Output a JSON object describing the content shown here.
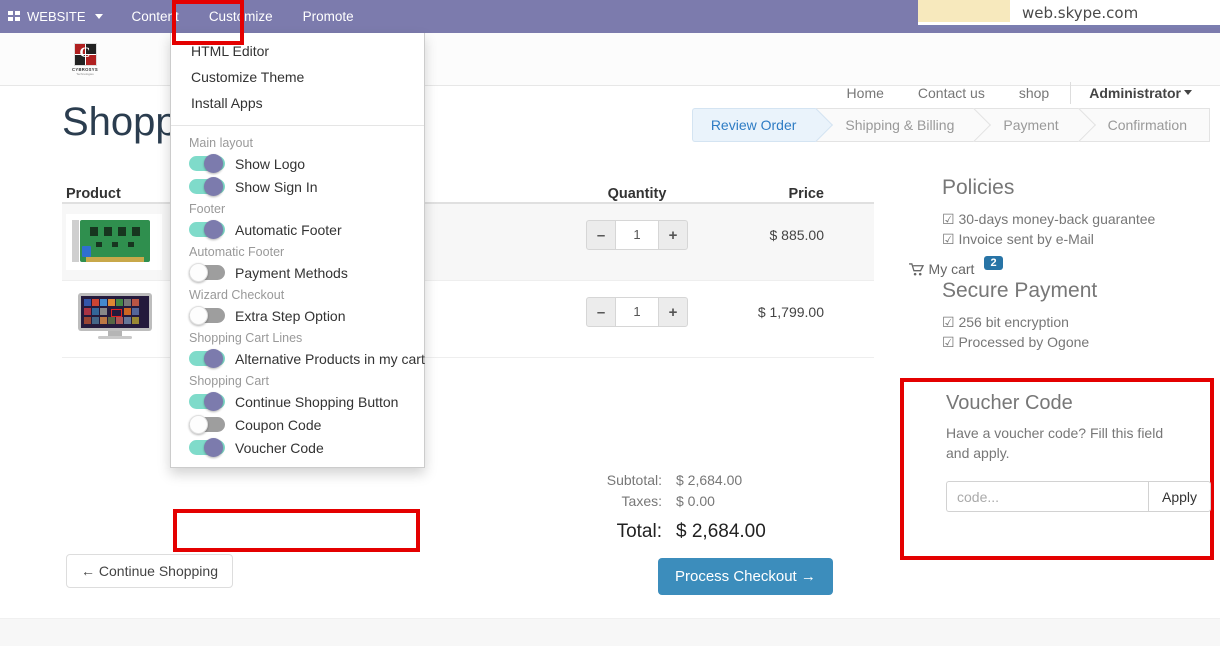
{
  "browser": {
    "url": "web.skype.com",
    "tab_title": ""
  },
  "topbar": {
    "brand": "WEBSITE",
    "brand_icon": "grid-icon",
    "caret_icon": "caret-down-icon",
    "items": [
      {
        "label": "Content",
        "active": false
      },
      {
        "label": "Customize",
        "active": true
      },
      {
        "label": "Promote",
        "active": false
      }
    ]
  },
  "customize_menu": {
    "links": [
      "HTML Editor",
      "Customize Theme",
      "Install Apps"
    ],
    "groups": [
      {
        "heading": "Main layout",
        "options": [
          {
            "label": "Show Logo",
            "on": true
          },
          {
            "label": "Show Sign In",
            "on": true
          }
        ]
      },
      {
        "heading": "Footer",
        "options": [
          {
            "label": "Automatic Footer",
            "on": true
          }
        ]
      },
      {
        "heading": "Automatic Footer",
        "options": [
          {
            "label": "Payment Methods",
            "on": false
          }
        ]
      },
      {
        "heading": "Wizard Checkout",
        "options": [
          {
            "label": "Extra Step Option",
            "on": false
          }
        ]
      },
      {
        "heading": "Shopping Cart Lines",
        "options": [
          {
            "label": "Alternative Products in my cart",
            "on": true
          }
        ]
      },
      {
        "heading": "Shopping Cart",
        "options": [
          {
            "label": "Continue Shopping Button",
            "on": true
          },
          {
            "label": "Coupon Code",
            "on": false
          },
          {
            "label": "Voucher Code",
            "on": true
          }
        ]
      }
    ]
  },
  "site_header": {
    "logo_text": "CYBROSYS",
    "logo_sub": "Technologies",
    "logo_letter": "C",
    "nav": [
      "Home",
      "Contact us",
      "shop"
    ],
    "cart_label": "My cart",
    "cart_icon": "shopping-cart-icon",
    "cart_count": "2",
    "user": "Administrator"
  },
  "page": {
    "title": "Shopp"
  },
  "wizard": {
    "steps": [
      {
        "label": "Review Order",
        "active": true
      },
      {
        "label": "Shipping & Billing",
        "active": false
      },
      {
        "label": "Payment",
        "active": false
      },
      {
        "label": "Confirmation",
        "active": false
      }
    ]
  },
  "cart": {
    "headers": {
      "product": "Product",
      "quantity": "Quantity",
      "price": "Price"
    },
    "rows": [
      {
        "thumb": "pci-card-image",
        "qty": "1",
        "price": "$ 885.00",
        "highlight": true
      },
      {
        "thumb": "monitor-image",
        "qty": "1",
        "price": "$ 1,799.00",
        "highlight": false
      }
    ],
    "qty_minus_icon": "minus-icon",
    "qty_plus_icon": "plus-icon"
  },
  "totals": {
    "subtotal_label": "Subtotal:",
    "subtotal_value": "$ 2,684.00",
    "taxes_label": "Taxes:",
    "taxes_value": "$ 0.00",
    "total_label": "Total:",
    "total_value": "$ 2,684.00",
    "checkout_button": "Process Checkout →"
  },
  "continue_shopping": "← Continue Shopping",
  "policies": {
    "heading": "Policies",
    "items": [
      "☑ 30-days money-back guarantee",
      "☑ Invoice sent by e-Mail"
    ]
  },
  "secure_payment": {
    "heading": "Secure Payment",
    "items": [
      "☑ 256 bit encryption",
      "☑ Processed by Ogone"
    ]
  },
  "voucher": {
    "heading": "Voucher Code",
    "description": "Have a voucher code? Fill this field and apply.",
    "input_placeholder": "code...",
    "input_value": "",
    "apply_label": "Apply"
  },
  "colors": {
    "topbar": "#7c7bad",
    "accent_blue": "#3c8dbc",
    "highlight_red": "#e40000",
    "toggle_on_track": "#7fdbca",
    "toggle_on_knob": "#7c7bad",
    "toggle_off_track": "#9e9e9e"
  }
}
